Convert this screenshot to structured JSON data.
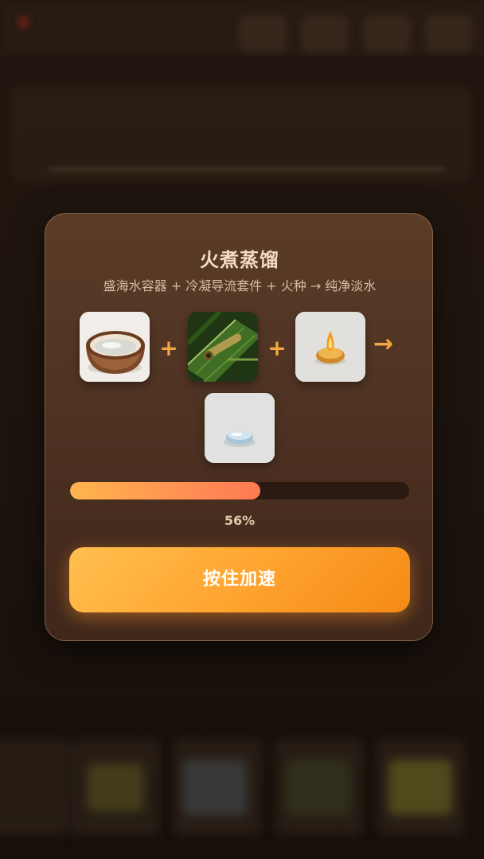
{
  "modal": {
    "title": "火煮蒸馏",
    "recipe_text": "盛海水容器 + 冷凝导流套件 + 火种 → 纯净淡水",
    "ingredients": [
      {
        "icon": "coconut-shell-icon"
      },
      {
        "icon": "leaf-tube-kit-icon"
      },
      {
        "icon": "fire-icon"
      }
    ],
    "operators": {
      "plus": "+",
      "arrow": "→"
    },
    "result": {
      "icon": "fresh-water-icon"
    },
    "progress": {
      "value": 0.56,
      "label": "56%"
    },
    "button_label": "按住加速"
  },
  "colors": {
    "accent": "#f2a742",
    "button_start": "#ffbf4f",
    "button_end": "#f48a14",
    "progress_start": "#ffb54d",
    "progress_end": "#ff7a52",
    "modal_bg": "#4a2f20"
  }
}
